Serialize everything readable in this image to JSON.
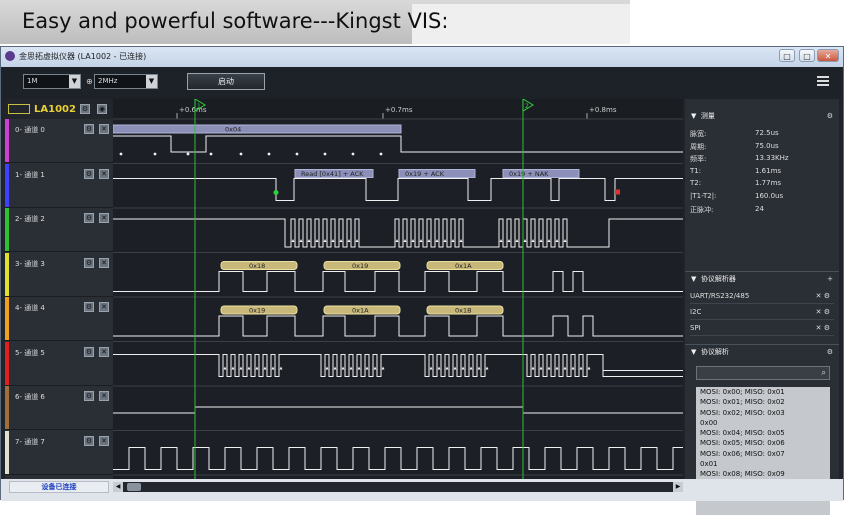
{
  "caption": "Easy and powerful software---Kingst VIS:",
  "window": {
    "title": "金思拓虚拟仪器 (LA1002 - 已连接)",
    "buttons": [
      "□",
      "□",
      "✕"
    ]
  },
  "toolbar": {
    "sample_depth": "1M",
    "sample_rate": "2MHz",
    "start_label": "启动",
    "hz_icon": "⊕"
  },
  "device": {
    "name": "LA1002"
  },
  "channels": [
    {
      "label": "0-  通道 0",
      "color": "#d040d0"
    },
    {
      "label": "1-  通道 1",
      "color": "#4040ff"
    },
    {
      "label": "2-  通道 2",
      "color": "#30c030"
    },
    {
      "label": "3-  通道 3",
      "color": "#e0e030"
    },
    {
      "label": "4-  通道 4",
      "color": "#f0a020"
    },
    {
      "label": "5-  通道 5",
      "color": "#e02020"
    },
    {
      "label": "6-  通道 6",
      "color": "#a0703a"
    },
    {
      "label": "7-  通道 7",
      "color": "#e0e0d0"
    }
  ],
  "timeline": {
    "ticks": [
      "+0.6ms",
      "+0.7ms",
      "+0.8ms"
    ],
    "marker1": "1",
    "marker2": "2"
  },
  "annotations": {
    "ch0": "0x04",
    "ch1": [
      "Read [0x41] + ACK",
      "0x19 + ACK",
      "0x19 + NAK"
    ],
    "ch3": [
      "0x18",
      "0x19",
      "0x1A"
    ],
    "ch4": [
      "0x19",
      "0x1A",
      "0x1B"
    ]
  },
  "measurement": {
    "header": "测量",
    "rows": [
      {
        "label": "脉宽:",
        "value": "72.5us"
      },
      {
        "label": "周期:",
        "value": "75.0us"
      },
      {
        "label": "频率:",
        "value": "13.33KHz"
      },
      {
        "label": "T1:",
        "value": "1.61ms"
      },
      {
        "label": "T2:",
        "value": "1.77ms"
      },
      {
        "label": "|T1-T2|:",
        "value": "160.0us"
      },
      {
        "label": "正脉冲:",
        "value": "24"
      }
    ]
  },
  "analyzers": {
    "header": "协议解析器",
    "items": [
      "UART/RS232/485",
      "I2C",
      "SPI"
    ]
  },
  "decode": {
    "header": "协议解析",
    "lines": [
      "MOSI: 0x00;  MISO: 0x01",
      "MOSI: 0x01;  MISO: 0x02",
      "MOSI: 0x02;  MISO: 0x03",
      "0x00",
      "MOSI: 0x04;  MISO: 0x05",
      "MOSI: 0x05;  MISO: 0x06",
      "MOSI: 0x06;  MISO: 0x07",
      "0x01",
      "MOSI: 0x08;  MISO: 0x09",
      "MOSI: 0x09;  MISO: 0x0A"
    ]
  },
  "status": {
    "connection": "设备已连接"
  }
}
